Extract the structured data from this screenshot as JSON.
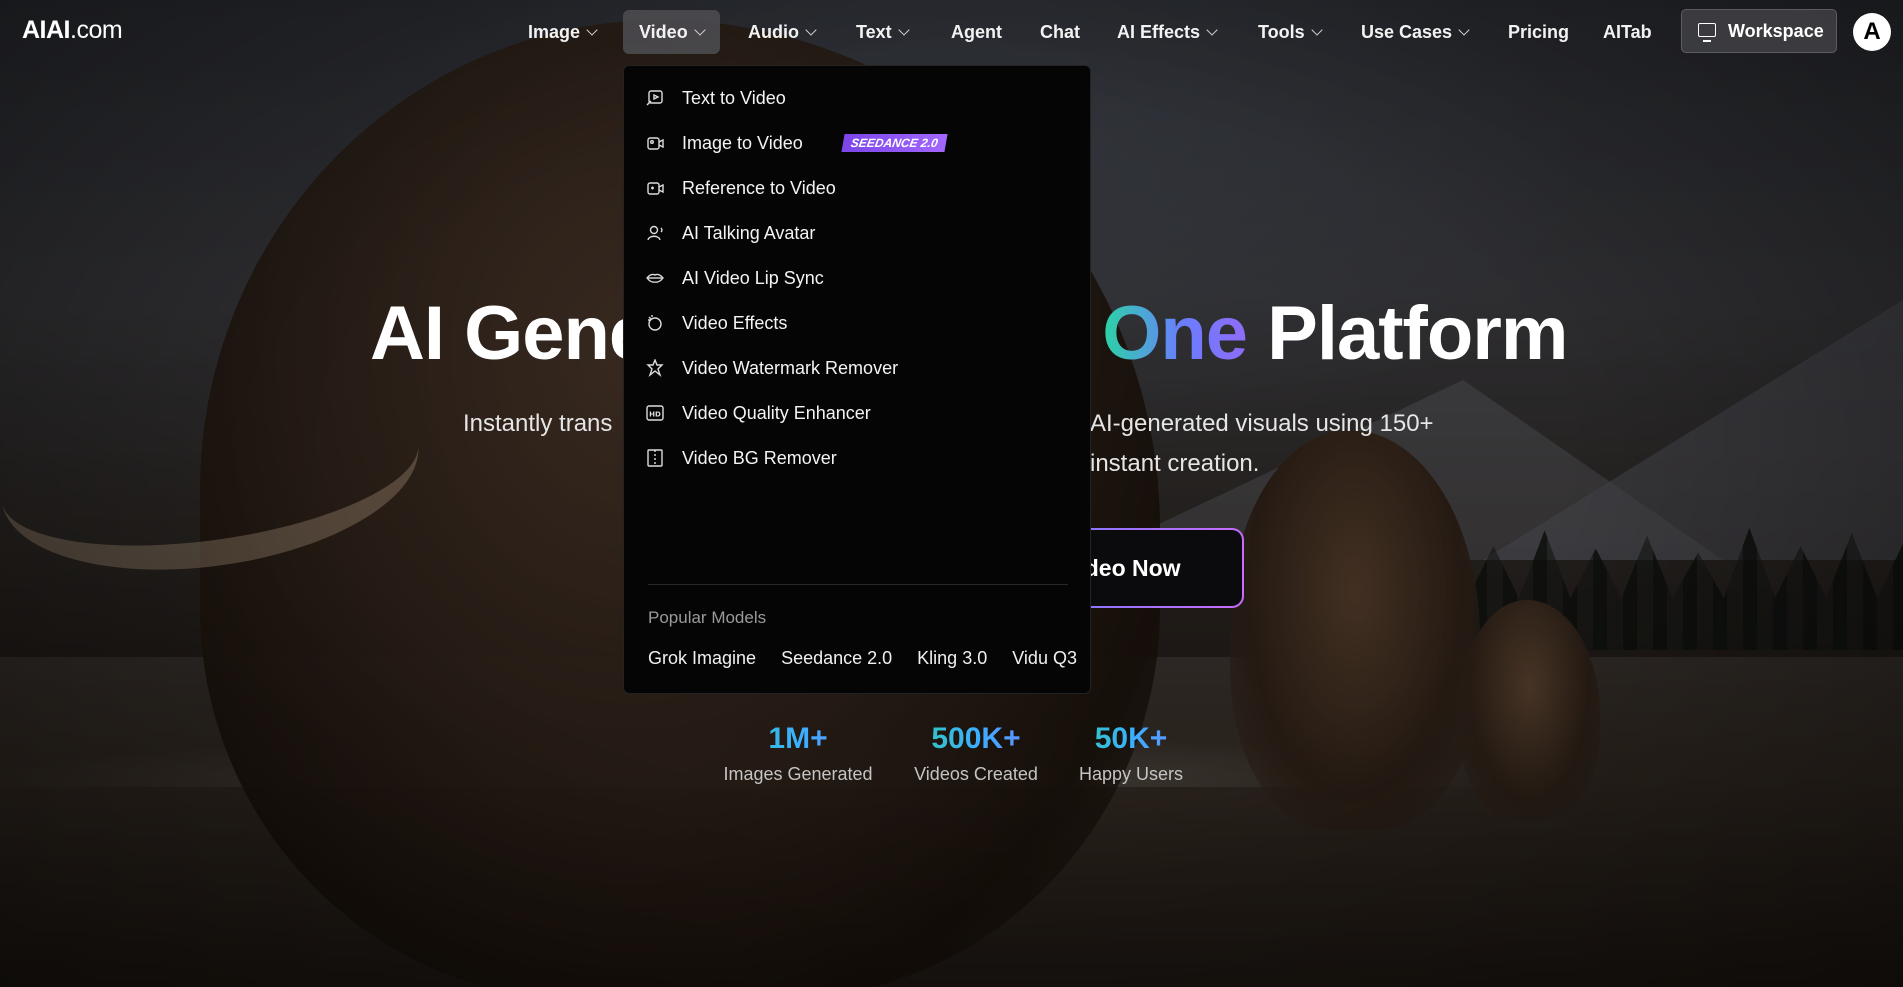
{
  "brand": {
    "name": "AIAI",
    "tld": ".com"
  },
  "nav": {
    "items": [
      {
        "label": "Image",
        "has_dropdown": true
      },
      {
        "label": "Video",
        "has_dropdown": true,
        "active": true
      },
      {
        "label": "Audio",
        "has_dropdown": true
      },
      {
        "label": "Text",
        "has_dropdown": true
      },
      {
        "label": "Agent",
        "has_dropdown": false
      },
      {
        "label": "Chat",
        "has_dropdown": false
      },
      {
        "label": "AI Effects",
        "has_dropdown": true
      },
      {
        "label": "Tools",
        "has_dropdown": true
      },
      {
        "label": "Use Cases",
        "has_dropdown": true
      },
      {
        "label": "Pricing",
        "has_dropdown": false
      },
      {
        "label": "AITab",
        "has_dropdown": false
      }
    ],
    "workspace_label": "Workspace",
    "avatar_letter": "A"
  },
  "hero": {
    "title_part1": "AI Gene",
    "title_highlight": "One",
    "title_part2": " Platform",
    "subtitle_line1_left": "Instantly trans",
    "subtitle_line1_right": "AI-generated visuals using 150+",
    "subtitle_line2_right": "instant creation.",
    "cta_label": "Video Now"
  },
  "stats": [
    {
      "value": "1M+",
      "label": "Images Generated"
    },
    {
      "value": "500K+",
      "label": "Videos Created"
    },
    {
      "value": "50K+",
      "label": "Happy Users"
    }
  ],
  "video_menu": {
    "items": [
      {
        "label": "Text to Video",
        "icon": "text-video-icon"
      },
      {
        "label": "Image to Video",
        "icon": "image-video-icon",
        "badge": "SEEDANCE 2.0"
      },
      {
        "label": "Reference to Video",
        "icon": "reference-video-icon"
      },
      {
        "label": "AI Talking Avatar",
        "icon": "avatar-icon"
      },
      {
        "label": "AI Video Lip Sync",
        "icon": "lips-icon"
      },
      {
        "label": "Video Effects",
        "icon": "effects-icon"
      },
      {
        "label": "Video Watermark Remover",
        "icon": "watermark-icon"
      },
      {
        "label": "Video Quality Enhancer",
        "icon": "hd-icon"
      },
      {
        "label": "Video BG Remover",
        "icon": "bg-remover-icon"
      }
    ],
    "popular_heading": "Popular Models",
    "popular_models": [
      "Grok Imagine",
      "Seedance 2.0",
      "Kling 3.0",
      "Vidu Q3"
    ]
  },
  "colors": {
    "accent_gradient_start": "#2bd4a4",
    "accent_gradient_end": "#8f6cf7",
    "badge_purple": "#8b55f0"
  }
}
